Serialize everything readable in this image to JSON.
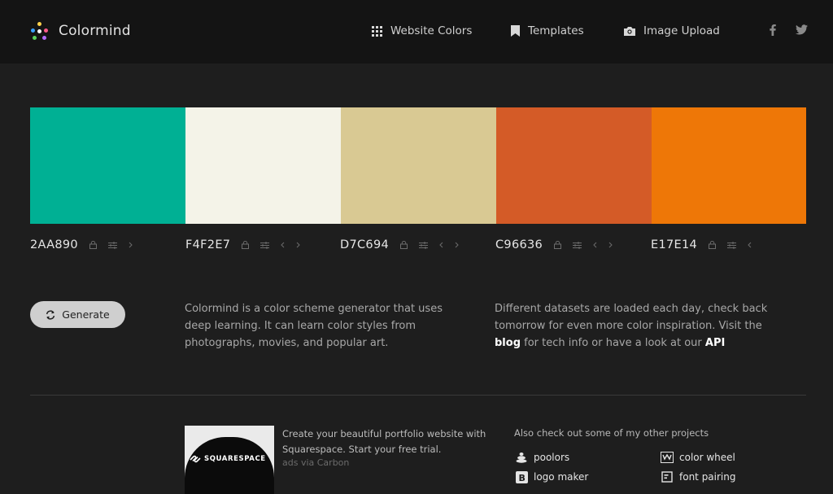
{
  "header": {
    "brand": "Colormind",
    "nav": [
      {
        "label": "Website Colors",
        "icon": "grid-icon"
      },
      {
        "label": "Templates",
        "icon": "bookmark-icon"
      },
      {
        "label": "Image Upload",
        "icon": "camera-icon"
      }
    ],
    "social": [
      {
        "label": "f",
        "icon": "facebook-icon"
      },
      {
        "label": "twitter",
        "icon": "twitter-icon"
      }
    ]
  },
  "palette": [
    {
      "hex": "2AA890",
      "color": "#00B094"
    },
    {
      "hex": "F4F2E7",
      "color": "#F4F3E8"
    },
    {
      "hex": "D7C694",
      "color": "#D9C993"
    },
    {
      "hex": "C96636",
      "color": "#D45B27"
    },
    {
      "hex": "E17E14",
      "color": "#EE7707"
    }
  ],
  "generate": {
    "label": "Generate"
  },
  "description": {
    "left": "Colormind is a color scheme generator that uses deep learning. It can learn color styles from photographs, movies, and popular art.",
    "right_pre": "Different datasets are loaded each day, check back tomorrow for even more color inspiration. Visit the",
    "right_blog": "blog",
    "right_mid": "for tech info or have a look at our",
    "right_api": "API"
  },
  "ad": {
    "brand": "SQUARESPACE",
    "text": "Create your beautiful portfolio website with Squarespace. Start your free trial.",
    "via": "ads via Carbon"
  },
  "other": {
    "title": "Also check out some of my other projects",
    "projects": [
      {
        "label": "poolors",
        "icon": "poolors-icon"
      },
      {
        "label": "color wheel",
        "icon": "color-wheel-icon"
      },
      {
        "label": "logo maker",
        "icon": "logo-maker-icon"
      },
      {
        "label": "font pairing",
        "icon": "font-pairing-icon"
      }
    ]
  }
}
